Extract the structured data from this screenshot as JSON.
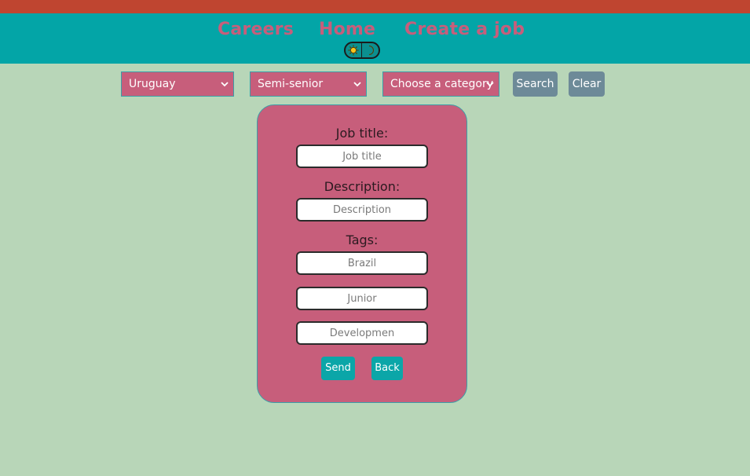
{
  "nav": {
    "links": [
      "Careers",
      "Home",
      "Create a job"
    ],
    "colors": {
      "top_strip": "#bf4530",
      "navbar": "#03a5a7",
      "link": "#c75e7b"
    },
    "theme_toggle": {
      "left_icon": "sun-icon",
      "right_icon": "moon-icon"
    }
  },
  "filters": {
    "country": "Uruguay",
    "level": "Semi-senior",
    "category": "Choose a category",
    "search_label": "Search",
    "clear_label": "Clear"
  },
  "form": {
    "job_title_label": "Job title:",
    "job_title_placeholder": "Job title",
    "description_label": "Description:",
    "description_placeholder": "Description",
    "tags_label": "Tags:",
    "tags_placeholders": [
      "Brazil",
      "Junior",
      "Developmen"
    ],
    "send_label": "Send",
    "back_label": "Back"
  },
  "colors": {
    "page_background": "#b8d6b8",
    "card": "#c75e7b",
    "select": "#c75e7b",
    "grey_button": "#6d8a98",
    "teal_button": "#0ba6a8"
  }
}
